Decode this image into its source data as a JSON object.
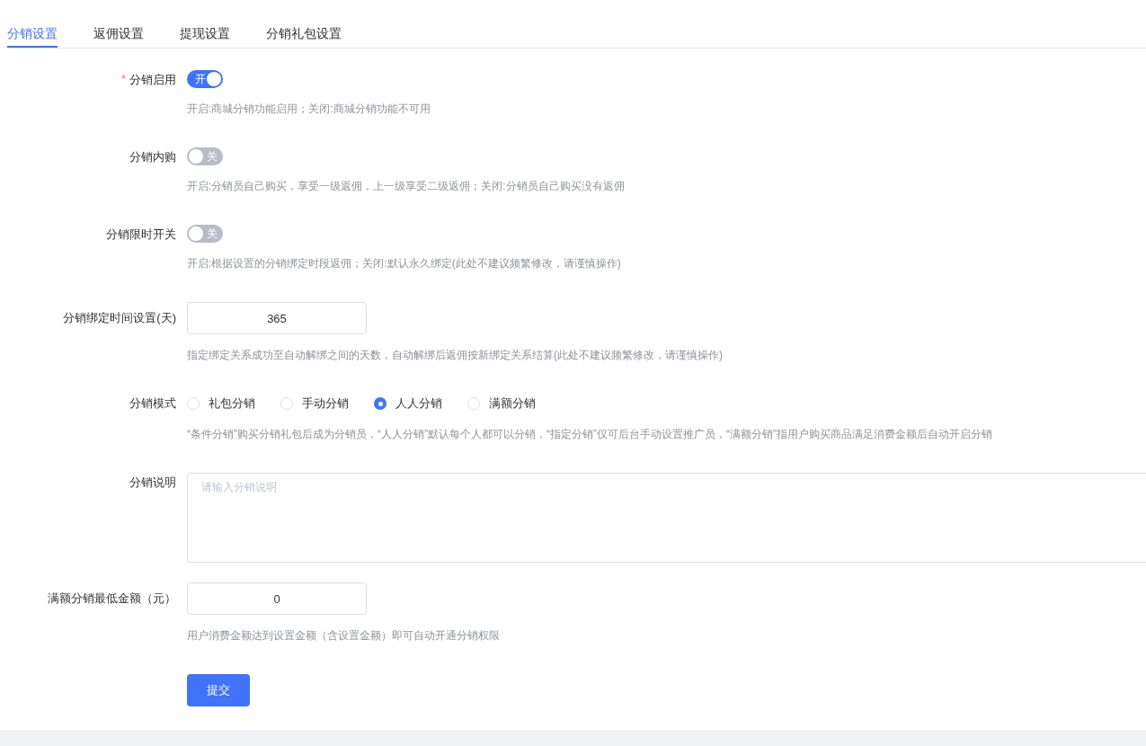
{
  "tabs": [
    {
      "label": "分销设置",
      "selected": true
    },
    {
      "label": "返佣设置",
      "selected": false
    },
    {
      "label": "提现设置",
      "selected": false
    },
    {
      "label": "分销礼包设置",
      "selected": false
    }
  ],
  "fields": [
    {
      "kind": "switch",
      "label": "分销启用",
      "required_mark": "*",
      "on": true,
      "text": "开",
      "help": "开启:商城分销功能启用；关闭:商城分销功能不可用"
    },
    {
      "kind": "switch",
      "label": "分销内购",
      "on": false,
      "text": "关",
      "help": "开启:分销员自己购买，享受一级返佣，上一级享受二级返佣；关闭:分销员自己购买没有返佣"
    },
    {
      "kind": "switch",
      "label": "分销限时开关",
      "on": false,
      "text": "关",
      "help": "开启:根据设置的分销绑定时段返佣；关闭:默认永久绑定(此处不建议频繁修改，请谨慎操作)"
    },
    {
      "kind": "input",
      "label": "分销绑定时间设置(天)",
      "value": "365",
      "help": "指定绑定关系成功至自动解绑之间的天数，自动解绑后返佣按新绑定关系结算(此处不建议频繁修改，请谨慎操作)"
    },
    {
      "kind": "radio",
      "label": "分销模式",
      "options": [
        {
          "label": "礼包分销",
          "selected": false
        },
        {
          "label": "手动分销",
          "selected": false
        },
        {
          "label": "人人分销",
          "selected": true
        },
        {
          "label": "满额分销",
          "selected": false
        }
      ],
      "help": "“条件分销”购买分销礼包后成为分销员，“人人分销”默认每个人都可以分销，“指定分销”仅可后台手动设置推广员，“满额分销”指用户购买商品满足消费金额后自动开启分销"
    },
    {
      "kind": "textarea",
      "label": "分销说明",
      "placeholder": "请输入分销说明"
    },
    {
      "kind": "input",
      "label": "满额分销最低金额（元）",
      "value": "0",
      "help": "用户消费金额达到设置金额（含设置金额）即可自动开通分销权限"
    }
  ],
  "submit": "提交"
}
